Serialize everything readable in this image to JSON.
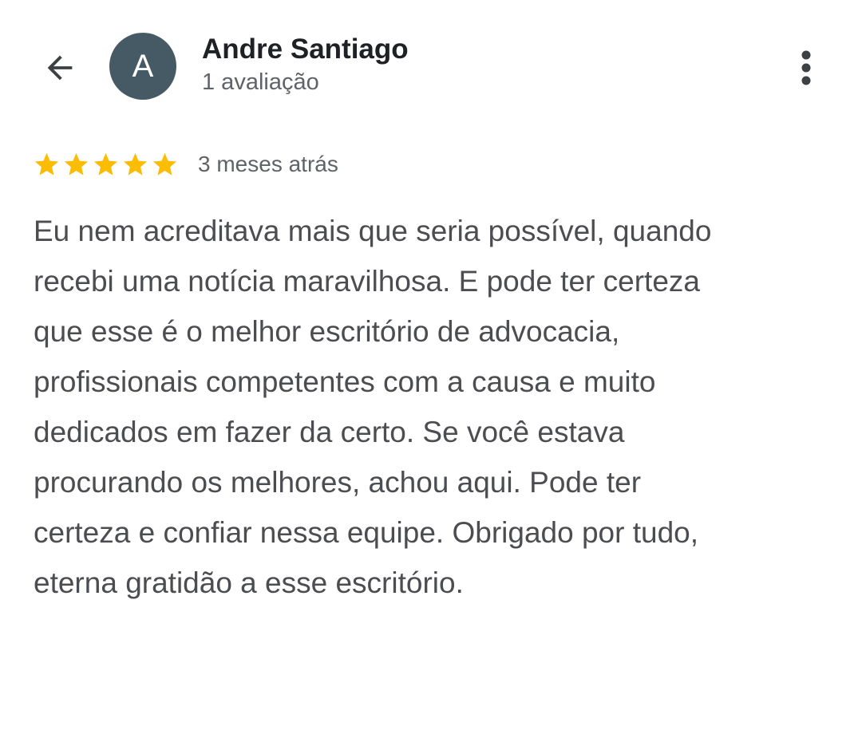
{
  "header": {
    "back_icon": "arrow-back-icon",
    "avatar": {
      "initial": "A",
      "color": "#455a64"
    },
    "name": "Andre Santiago",
    "review_count": "1 avaliação",
    "more_icon": "more-vert-icon"
  },
  "review": {
    "rating": 5,
    "rating_max": 5,
    "star_color": "#fbbc04",
    "date": "3 meses atrás",
    "text_lines": [
      "Eu nem acreditava mais que seria possível, quando",
      "recebi uma notícia maravilhosa. E pode ter certeza",
      "que esse é o melhor escritório de advocacia,",
      "profissionais competentes com a causa e muito",
      "dedicados em fazer da certo. Se você estava",
      "procurando os melhores, achou aqui. Pode ter",
      "certeza e confiar nessa equipe. Obrigado por tudo,",
      "eterna gratidão a esse escritório."
    ]
  }
}
